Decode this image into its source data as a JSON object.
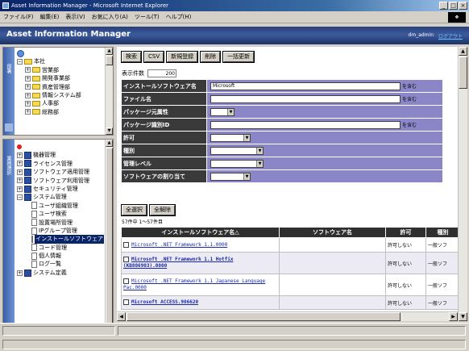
{
  "window": {
    "title": "Asset Information Manager - Microsoft Internet Explorer"
  },
  "menubar": [
    "ファイル(F)",
    "編集(E)",
    "表示(V)",
    "お気に入り(A)",
    "ツール(T)",
    "ヘルプ(H)"
  ],
  "app": {
    "title": "Asset Information Manager",
    "user": "dm_admin",
    "logout": "ログアウト"
  },
  "left_top": {
    "tab_label": "部署",
    "root": "本社",
    "items": [
      "営業部",
      "開発事業部",
      "資産管理部",
      "情報システム部",
      "人事部",
      "総務部"
    ]
  },
  "left_bottom": {
    "tab_label": "業務選択",
    "groups": [
      "機器管理",
      "ライセンス管理",
      "ソフトウェア適用管理",
      "ソフトウェア利用管理",
      "セキュリティ管理",
      "システム管理"
    ],
    "system_items": [
      "ユーザ組織管理",
      "ユーザ検索",
      "設置場所管理",
      "IPグループ管理",
      "インストールソフトウェア",
      "コード管理",
      "個人情報",
      "ログ一覧"
    ],
    "last_group": "システム定義"
  },
  "toolbar": {
    "search": "検索",
    "csv": "CSV",
    "new": "新規登録",
    "delete": "削除",
    "bulk_update": "一括更新"
  },
  "display_count": {
    "label": "表示件数",
    "value": "200"
  },
  "form": {
    "installed_software_label": "インストールソフトウェア名",
    "installed_software_value": "Microsoft",
    "filename_label": "ファイル名",
    "package_origin_label": "パッケージ元属性",
    "package_id_label": "パッケージ識別ID",
    "permission_label": "許可",
    "type_label": "種別",
    "management_level_label": "管理レベル",
    "software_assignment_label": "ソフトウェアの割り当て",
    "contains_suffix": "を含む"
  },
  "select_buttons": {
    "select_all": "全選択",
    "deselect_all": "全解除"
  },
  "result_summary": "57件中 1～57件目",
  "grid": {
    "headers": [
      "インストールソフトウェア名△",
      "ソフトウェア名",
      "許可",
      "種別"
    ],
    "rows": [
      {
        "name": "Microsoft .NET Framework 1.1.0000",
        "software": "",
        "permission": "許可しない",
        "type": "一般ソフ"
      },
      {
        "name": "Microsoft .NET Framework 1.1 Hotfix (KB886903).0000",
        "software": "",
        "permission": "許可しない",
        "type": "一般ソフ"
      },
      {
        "name": "Microsoft .NET Framework 1.1 Japanese Language Pac.0000",
        "software": "",
        "permission": "許可しない",
        "type": "一般ソフ"
      },
      {
        "name": "Microsoft ACCESS.906620",
        "software": "",
        "permission": "許可しない",
        "type": "一般ソフ"
      }
    ]
  }
}
